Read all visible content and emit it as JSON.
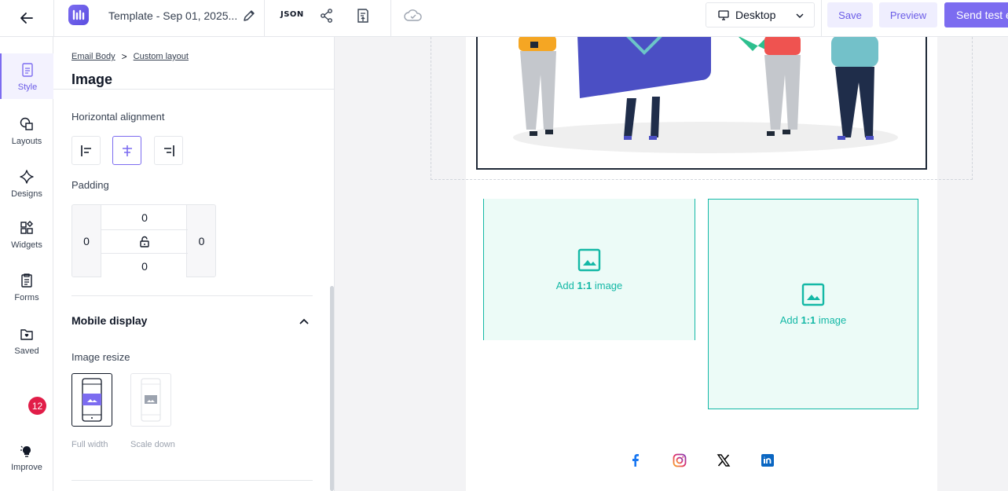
{
  "topbar": {
    "template_name": "Template - Sep 01, 2025...",
    "json_label": "JSON",
    "device": "Desktop",
    "save_label": "Save",
    "preview_label": "Preview",
    "send_test_label": "Send test e"
  },
  "rail": {
    "items": [
      {
        "label": "Style",
        "icon": "style-icon"
      },
      {
        "label": "Layouts",
        "icon": "layouts-icon"
      },
      {
        "label": "Designs",
        "icon": "designs-icon"
      },
      {
        "label": "Widgets",
        "icon": "widgets-icon"
      },
      {
        "label": "Forms",
        "icon": "forms-icon"
      },
      {
        "label": "Saved",
        "icon": "saved-icon"
      }
    ],
    "improve_label": "Improve",
    "improve_badge": "12"
  },
  "panel": {
    "breadcrumb": [
      "Email Body",
      "Custom layout"
    ],
    "breadcrumb_sep": ">",
    "title": "Image",
    "horizontal_alignment_label": "Horizontal alignment",
    "alignment_selected": "center",
    "padding_label": "Padding",
    "padding": {
      "top": "0",
      "left": "0",
      "right": "0",
      "bottom": "0"
    },
    "mobile_display_label": "Mobile display",
    "image_resize_label": "Image resize",
    "resize_options": [
      "Full width",
      "Scale down"
    ],
    "resize_selected": "Full width"
  },
  "canvas": {
    "placeholder_left": {
      "prefix": "Add ",
      "ratio": "1:1",
      "suffix": " image"
    },
    "placeholder_right": {
      "prefix": "Add ",
      "ratio": "1:1",
      "suffix": " image"
    },
    "social_icons": [
      "facebook-icon",
      "instagram-icon",
      "x-icon",
      "linkedin-icon"
    ]
  },
  "colors": {
    "accent": "#7c6cf0",
    "teal": "#14b8a6",
    "badge": "#e11d48"
  }
}
